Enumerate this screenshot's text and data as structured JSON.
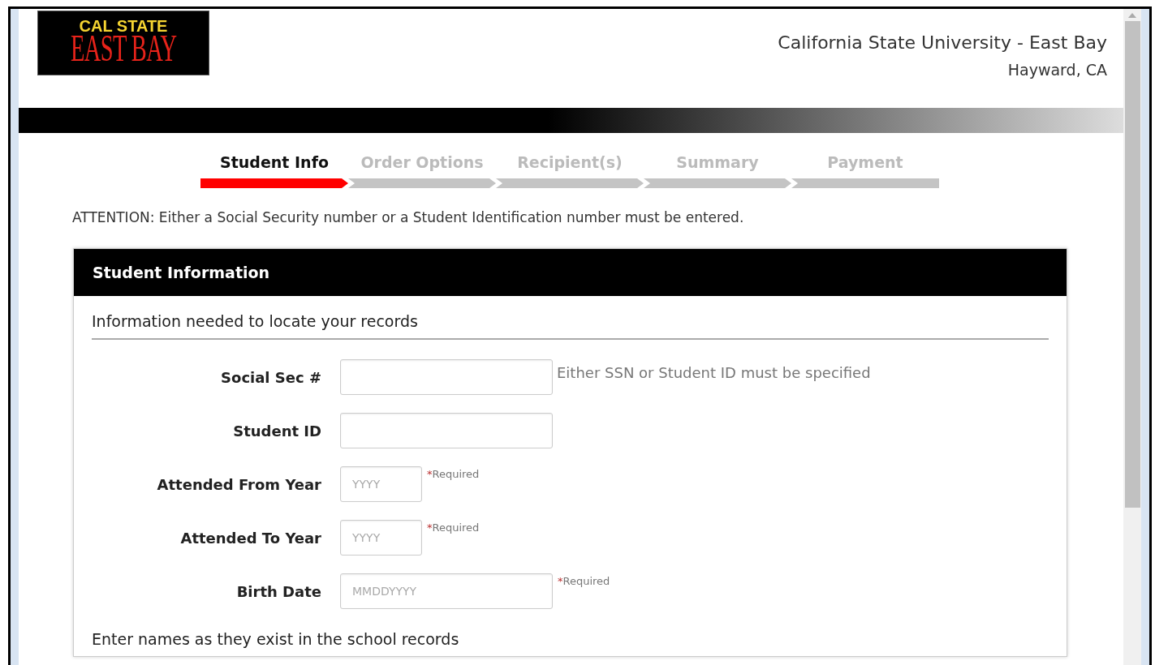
{
  "logo": {
    "top": "CAL STATE",
    "bottom": "EAST BAY"
  },
  "header": {
    "title": "California State University - East Bay",
    "location": "Hayward, CA"
  },
  "steps": [
    {
      "label": "Student Info",
      "selected": true
    },
    {
      "label": "Order Options",
      "selected": false
    },
    {
      "label": "Recipient(s)",
      "selected": false
    },
    {
      "label": "Summary",
      "selected": false
    },
    {
      "label": "Payment",
      "selected": false
    }
  ],
  "attention": "ATTENTION: Either a Social Security number or a Student Identification number must be entered.",
  "card": {
    "title": "Student Information",
    "sections": [
      {
        "heading": "Information needed to locate your records",
        "fields": [
          {
            "label": "Social Sec #",
            "kind": "wide",
            "note": {
              "kind": "hint",
              "text": "Either SSN or Student ID must be specified"
            }
          },
          {
            "label": "Student ID",
            "kind": "wide"
          },
          {
            "label": "Attended From Year",
            "kind": "narrow",
            "placeholder": "YYYY",
            "note": {
              "kind": "required",
              "mark": "*",
              "text": "Required"
            }
          },
          {
            "label": "Attended To Year",
            "kind": "narrow",
            "placeholder": "YYYY",
            "note": {
              "kind": "required",
              "mark": "*",
              "text": "Required"
            }
          },
          {
            "label": "Birth Date",
            "kind": "wide",
            "placeholder": "MMDDYYYY",
            "note": {
              "kind": "required",
              "mark": "*",
              "text": "Required"
            }
          }
        ]
      },
      {
        "heading": "Enter names as they exist in the school records"
      }
    ]
  }
}
